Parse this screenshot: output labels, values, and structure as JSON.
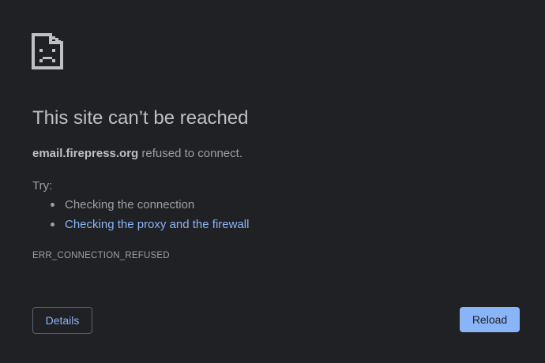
{
  "page": {
    "icon": "sad-page-icon",
    "title": "This site can’t be reached",
    "summary_domain": "email.firepress.org",
    "summary_rest": " refused to connect.",
    "try_label": "Try:",
    "suggestions": [
      {
        "text": "Checking the connection",
        "is_link": false
      },
      {
        "text": "Checking the proxy and the firewall",
        "is_link": true
      }
    ],
    "error_code": "ERR_CONNECTION_REFUSED"
  },
  "buttons": {
    "details_label": "Details",
    "reload_label": "Reload"
  },
  "colors": {
    "background": "#202124",
    "text": "#9aa0a6",
    "title": "#bdc1c6",
    "link": "#8ab4f8",
    "primary_button": "#8ab4f8"
  }
}
